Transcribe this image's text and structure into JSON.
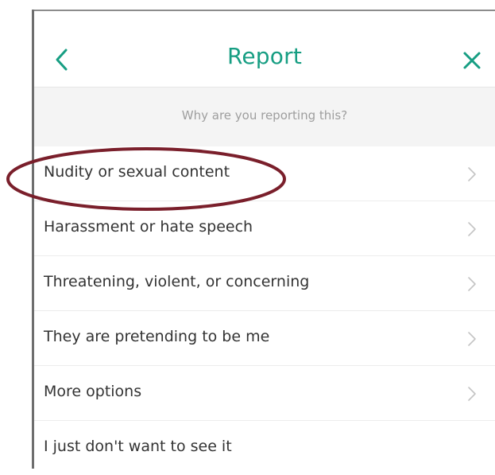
{
  "header": {
    "title": "Report",
    "back_icon": "chevron-left-icon",
    "close_icon": "close-icon",
    "accent_color": "#179e83"
  },
  "subheader": {
    "text": "Why are you reporting this?"
  },
  "options": [
    {
      "label": "Nudity or sexual content",
      "has_chevron": true
    },
    {
      "label": "Harassment or hate speech",
      "has_chevron": true
    },
    {
      "label": "Threatening, violent, or concerning",
      "has_chevron": true
    },
    {
      "label": "They are pretending to be me",
      "has_chevron": true
    },
    {
      "label": "More options",
      "has_chevron": true
    },
    {
      "label": "I just don't want to see it",
      "has_chevron": false
    }
  ],
  "annotation": {
    "highlighted_option": "Nudity or sexual content",
    "color": "#7a1f2b"
  }
}
